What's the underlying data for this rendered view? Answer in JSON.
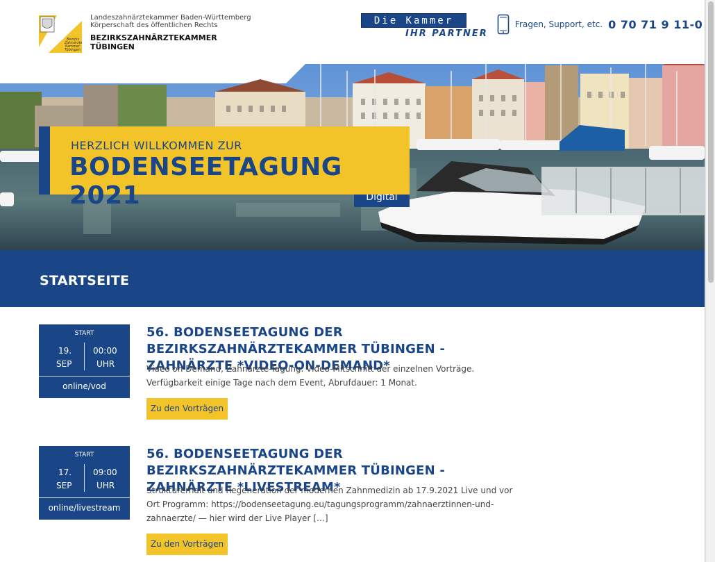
{
  "header": {
    "org_line1": "Landeszahnärztekammer Baden-Württemberg",
    "org_line2": "Körperschaft des öffentlichen Rechts",
    "org_line3": "BEZIRKSZAHNÄRZTEKAMMER",
    "org_line4": "TÜBINGEN",
    "logo_text": [
      "Bezirks",
      "Zahnärzte",
      "Kammer",
      "Tübingen"
    ],
    "kammer_top": "Die Kammer",
    "kammer_bottom": "IHR PARTNER",
    "contact_label": "Fragen, Support, etc.",
    "contact_number": "0 70 71 9 11-0"
  },
  "hero": {
    "welcome_small": "HERZLICH WILLKOMMEN ZUR",
    "welcome_big": "BODENSEETAGUNG 2021",
    "badge": "Digital"
  },
  "page_title": "STARTSEITE",
  "events": [
    {
      "start_label": "START",
      "day": "19.",
      "month": "SEP",
      "time": "00:00",
      "uhr": "UHR",
      "mode": "online/vod",
      "headline": "56. BODENSEETAGUNG DER BEZIRKSZAHNÄRZTEKAMMER TÜBINGEN - ZAHNÄRZTE *VIDEO-ON-DEMAND*",
      "description": "Video on Demand, Zahnärzte-Tagung. Video-Mitschnitt der einzelnen Vorträge. Verfügbarkeit einige Tage nach dem Event, Abrufdauer: 1 Monat.",
      "button": "Zu den Vorträgen"
    },
    {
      "start_label": "START",
      "day": "17.",
      "month": "SEP",
      "time": "09:00",
      "uhr": "UHR",
      "mode": "online/livestream",
      "headline": "56. BODENSEETAGUNG DER BEZIRKSZAHNÄRZTEKAMMER TÜBINGEN - ZAHNÄRZTE *LIVESTREAM*",
      "description": "Strukturerhalt und Regeneration der modernen Zahnmedizin ab 17.9.2021 Live und vor Ort Programm: https://bodenseetagung.eu/tagungsprogramm/zahnaerztinnen-und-zahnaerzte/ — hier wird der Live Player […]",
      "button": "Zu den Vorträgen"
    }
  ],
  "colors": {
    "brand_blue": "#1a4687",
    "brand_yellow": "#f3c32a"
  }
}
